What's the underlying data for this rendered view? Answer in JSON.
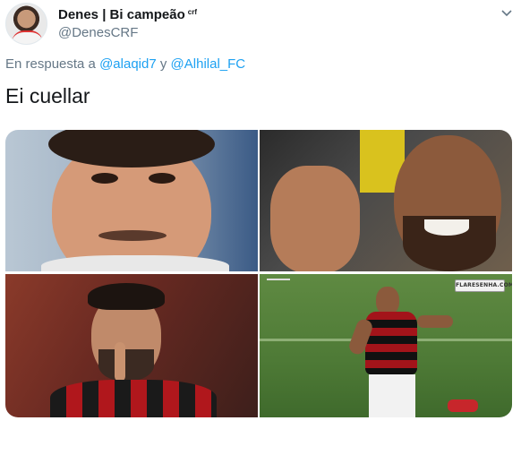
{
  "author": {
    "display_name": "Denes | Bi campeão",
    "name_suffix": "crf",
    "handle": "@DenesCRF"
  },
  "reply": {
    "prefix": "En respuesta a",
    "mention_1": "@alaqid7",
    "connector": "y",
    "mention_2": "@Alhilal_FC"
  },
  "tweet": {
    "text": "Ei cuellar"
  },
  "media": {
    "logo_text": "FLARESENHA.COM"
  },
  "colors": {
    "link": "#1da1f2",
    "secondary_text": "#657786",
    "primary_text": "#14171a"
  },
  "icons": {
    "menu": "chevron-down-icon"
  }
}
